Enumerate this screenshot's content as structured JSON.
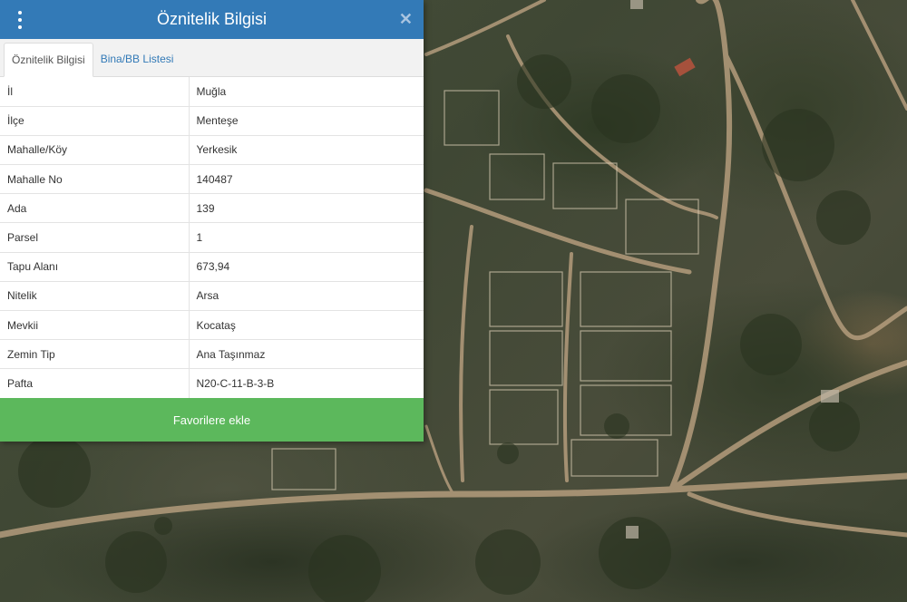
{
  "panel": {
    "title": "Öznitelik Bilgisi",
    "close_icon": "close-icon",
    "menu_icon": "kebab-menu-icon"
  },
  "tabs": [
    {
      "label": "Öznitelik Bilgisi",
      "active": true
    },
    {
      "label": "Bina/BB Listesi",
      "active": false
    }
  ],
  "attributes": [
    {
      "key": "İl",
      "value": "Muğla"
    },
    {
      "key": "İlçe",
      "value": "Menteşe"
    },
    {
      "key": "Mahalle/Köy",
      "value": "Yerkesik"
    },
    {
      "key": "Mahalle No",
      "value": "140487"
    },
    {
      "key": "Ada",
      "value": "139"
    },
    {
      "key": "Parsel",
      "value": "1"
    },
    {
      "key": "Tapu Alanı",
      "value": "673,94"
    },
    {
      "key": "Nitelik",
      "value": "Arsa"
    },
    {
      "key": "Mevkii",
      "value": "Kocataş"
    },
    {
      "key": "Zemin Tip",
      "value": "Ana Taşınmaz"
    },
    {
      "key": "Pafta",
      "value": "N20-C-11-B-3-B"
    }
  ],
  "actions": {
    "favorite_label": "Favorilere ekle"
  },
  "colors": {
    "header": "#337ab7",
    "favorite_button": "#5cb85c",
    "tab_link": "#337ab7"
  }
}
